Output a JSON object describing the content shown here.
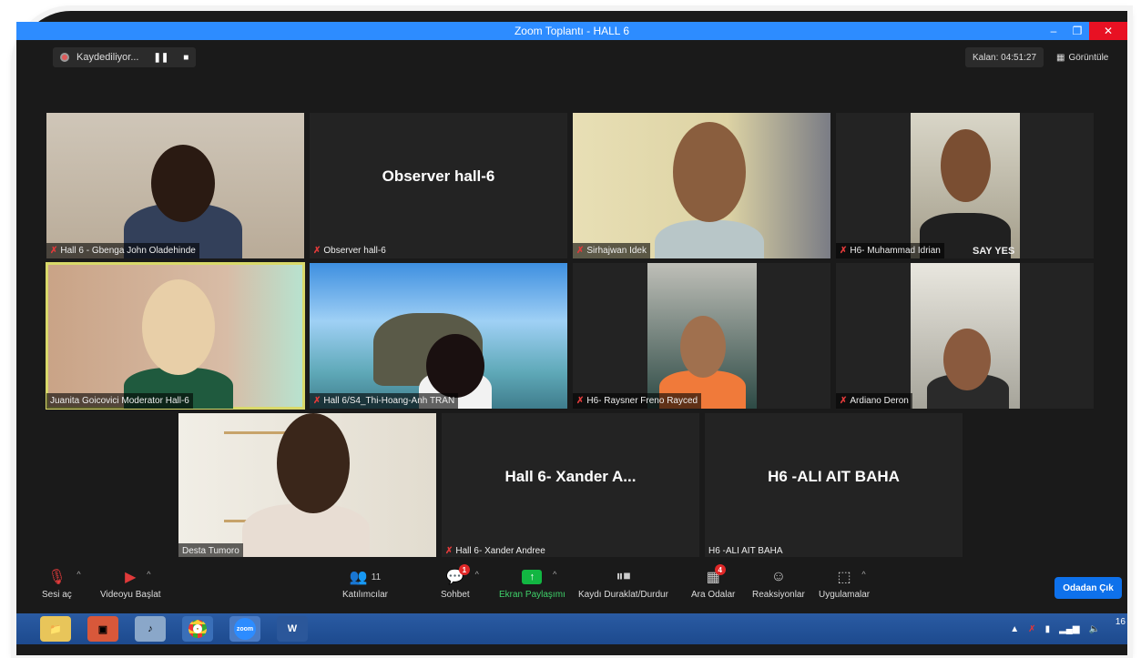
{
  "window": {
    "title": "Zoom Toplantı - HALL 6"
  },
  "top_bar": {
    "recording_label": "Kaydediliyor...",
    "timer": "Kalan: 04:51:27",
    "view_label": "Görüntüle"
  },
  "tiles": [
    {
      "name": "Hall 6 - Gbenga John Oladehinde",
      "muted": true
    },
    {
      "name": "Observer hall-6",
      "display": "Observer hall-6",
      "muted": true
    },
    {
      "name": "Sirhajwan Idek",
      "muted": true
    },
    {
      "name": "H6- Muhammad Idrian",
      "muted": true,
      "shirt_text": "SAY YES"
    },
    {
      "name": "Juanita Goicovici Moderator Hall-6",
      "muted": false
    },
    {
      "name": "Hall 6/S4_Thi-Hoang-Anh TRAN",
      "muted": true
    },
    {
      "name": "H6- Raysner Freno Rayced",
      "muted": true
    },
    {
      "name": "Ardiano Deron",
      "muted": true
    },
    {
      "name": "Desta Tumoro",
      "muted": false
    },
    {
      "name": "Hall 6- Xander Andree",
      "display": "Hall 6- Xander A...",
      "muted": true
    },
    {
      "name": "H6 -ALI AIT BAHA",
      "display": "H6 -ALI AIT BAHA",
      "muted": false
    }
  ],
  "toolbar": {
    "audio_label": "Sesi aç",
    "video_label": "Videoyu Başlat",
    "participants_label": "Katılımcılar",
    "participants_count": "11",
    "chat_label": "Sohbet",
    "chat_badge": "1",
    "share_label": "Ekran Paylaşımı",
    "record_label": "Kaydı Duraklat/Durdur",
    "breakout_label": "Ara Odalar",
    "breakout_badge": "4",
    "reactions_label": "Reaksiyonlar",
    "apps_label": "Uygulamalar",
    "leave_label": "Odadan Çık"
  },
  "taskbar": {
    "zoom_label": "zoom",
    "word_label": "W",
    "clock": "16"
  },
  "colors": {
    "zoom_blue": "#2d8cff",
    "share_green": "#12b642",
    "muted_red": "#e03a3a",
    "active_speaker": "#d9d96a"
  }
}
